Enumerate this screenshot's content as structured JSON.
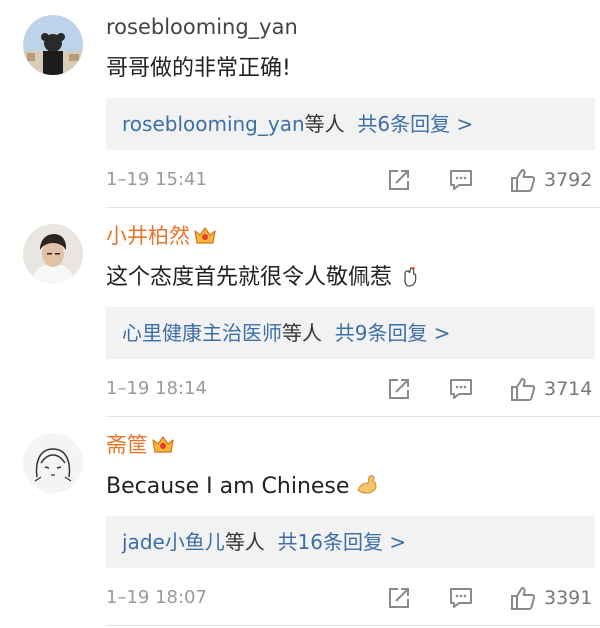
{
  "comments": [
    {
      "user": "roseblooming_yan",
      "vip": false,
      "text": "哥哥做的非常正确!",
      "emoji": "",
      "replies": {
        "who": "roseblooming_yan",
        "suffix": "等人",
        "total": "共6条回复 >"
      },
      "time": "1–19 15:41",
      "likes": "3792"
    },
    {
      "user": "小井柏然",
      "vip": true,
      "text": "这个态度首先就很令人敬佩惹",
      "emoji": "finger-heart-emoji",
      "replies": {
        "who": "心里健康主治医师",
        "suffix": "等人",
        "total": "共9条回复 >"
      },
      "time": "1–19 18:14",
      "likes": "3714"
    },
    {
      "user": "斋筐",
      "vip": true,
      "text": "Because I am Chinese",
      "emoji": "flexed-biceps-emoji",
      "replies": {
        "who": "jade小鱼儿",
        "suffix": "等人",
        "total": "共16条回复 >"
      },
      "time": "1–19 18:07",
      "likes": "3391"
    }
  ],
  "icons": {
    "share": "share-square-icon",
    "reply": "comment-bubble-icon",
    "like": "thumbs-up-icon",
    "crown": "vip-crown-icon"
  },
  "colors": {
    "vip_name": "#e8772b",
    "reply_link": "#3c6fa8",
    "meta_gray": "#9a9a9a",
    "reply_bg": "#f2f2f2"
  }
}
